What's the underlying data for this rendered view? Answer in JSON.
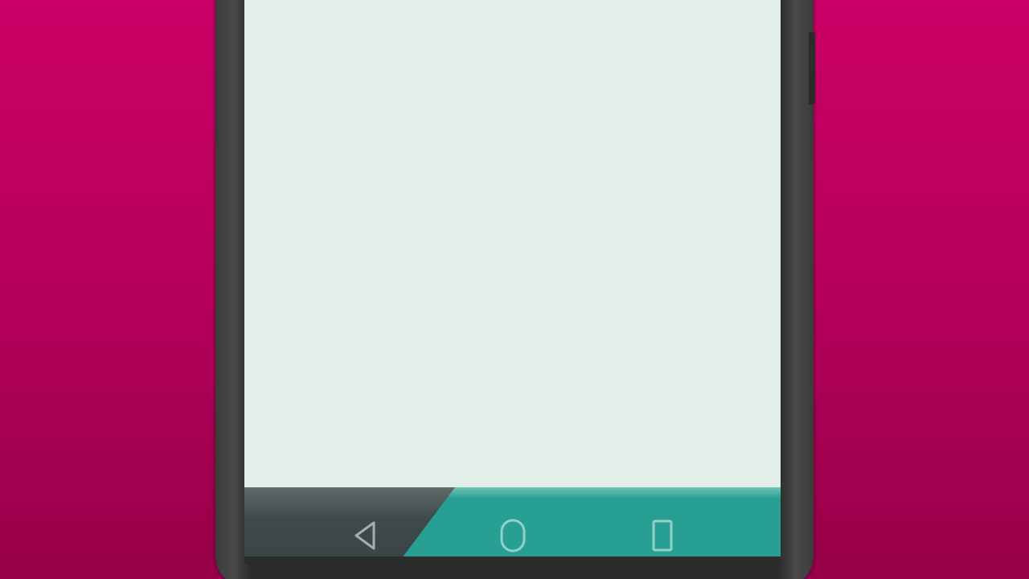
{
  "device": {
    "frame_color": "#2a2a2a",
    "background_gradient": [
      "#cc0066",
      "#980048"
    ]
  },
  "screen": {
    "background": "#e2eeea",
    "content": ""
  },
  "nav_bar": {
    "accent_color": "#27a093",
    "dark_color": "#3f4a4b",
    "buttons": [
      {
        "icon": "back-triangle-icon"
      },
      {
        "icon": "home-circle-icon"
      },
      {
        "icon": "recents-square-icon"
      }
    ]
  }
}
